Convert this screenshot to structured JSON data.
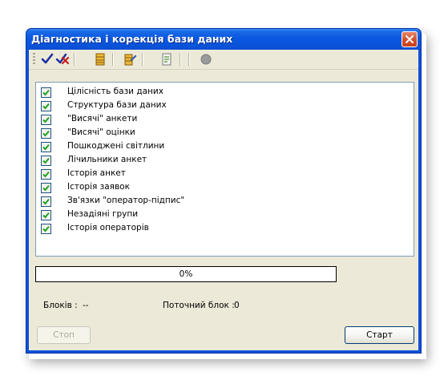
{
  "window": {
    "title": "Діагностика і корекція бази даних"
  },
  "toolbar": {
    "buttons": [
      {
        "icon": "check-all-icon",
        "color": "#1a2fa0"
      },
      {
        "icon": "uncheck-all-icon",
        "color": "#c81e1e"
      },
      {
        "icon": "database-icon",
        "color": "#d9a31c"
      },
      {
        "icon": "database-edit-icon",
        "color": "#d9a31c"
      },
      {
        "icon": "report-icon",
        "color": "#6aa84f"
      },
      {
        "icon": "stop-record-icon",
        "color": "#8c8c8c"
      }
    ]
  },
  "checklist": {
    "items": [
      {
        "label": "Цілісність бази даних",
        "checked": true
      },
      {
        "label": "Структура бази даних",
        "checked": true
      },
      {
        "label": "\"Висячі\" анкети",
        "checked": true
      },
      {
        "label": "\"Висячі\" оцінки",
        "checked": true
      },
      {
        "label": "Пошкоджені світлини",
        "checked": true
      },
      {
        "label": "Лічильники анкет",
        "checked": true
      },
      {
        "label": "Історія анкет",
        "checked": true
      },
      {
        "label": "Історія заявок",
        "checked": true
      },
      {
        "label": "Зв'язки \"оператор-підпис\"",
        "checked": true
      },
      {
        "label": "Незадіяні групи",
        "checked": true
      },
      {
        "label": "Історія операторів",
        "checked": true
      }
    ]
  },
  "progress": {
    "text": "0%",
    "value": 0
  },
  "status": {
    "blocks_label": "Блоків :",
    "blocks_value": "--",
    "current_block_label": "Поточний блок :",
    "current_block_value": "0"
  },
  "buttons": {
    "stop_label": "Стоп",
    "start_label": "Старт"
  },
  "colors": {
    "titlebar": "#0a55dc",
    "checkmark": "#21a121",
    "face": "#ece9d8"
  }
}
